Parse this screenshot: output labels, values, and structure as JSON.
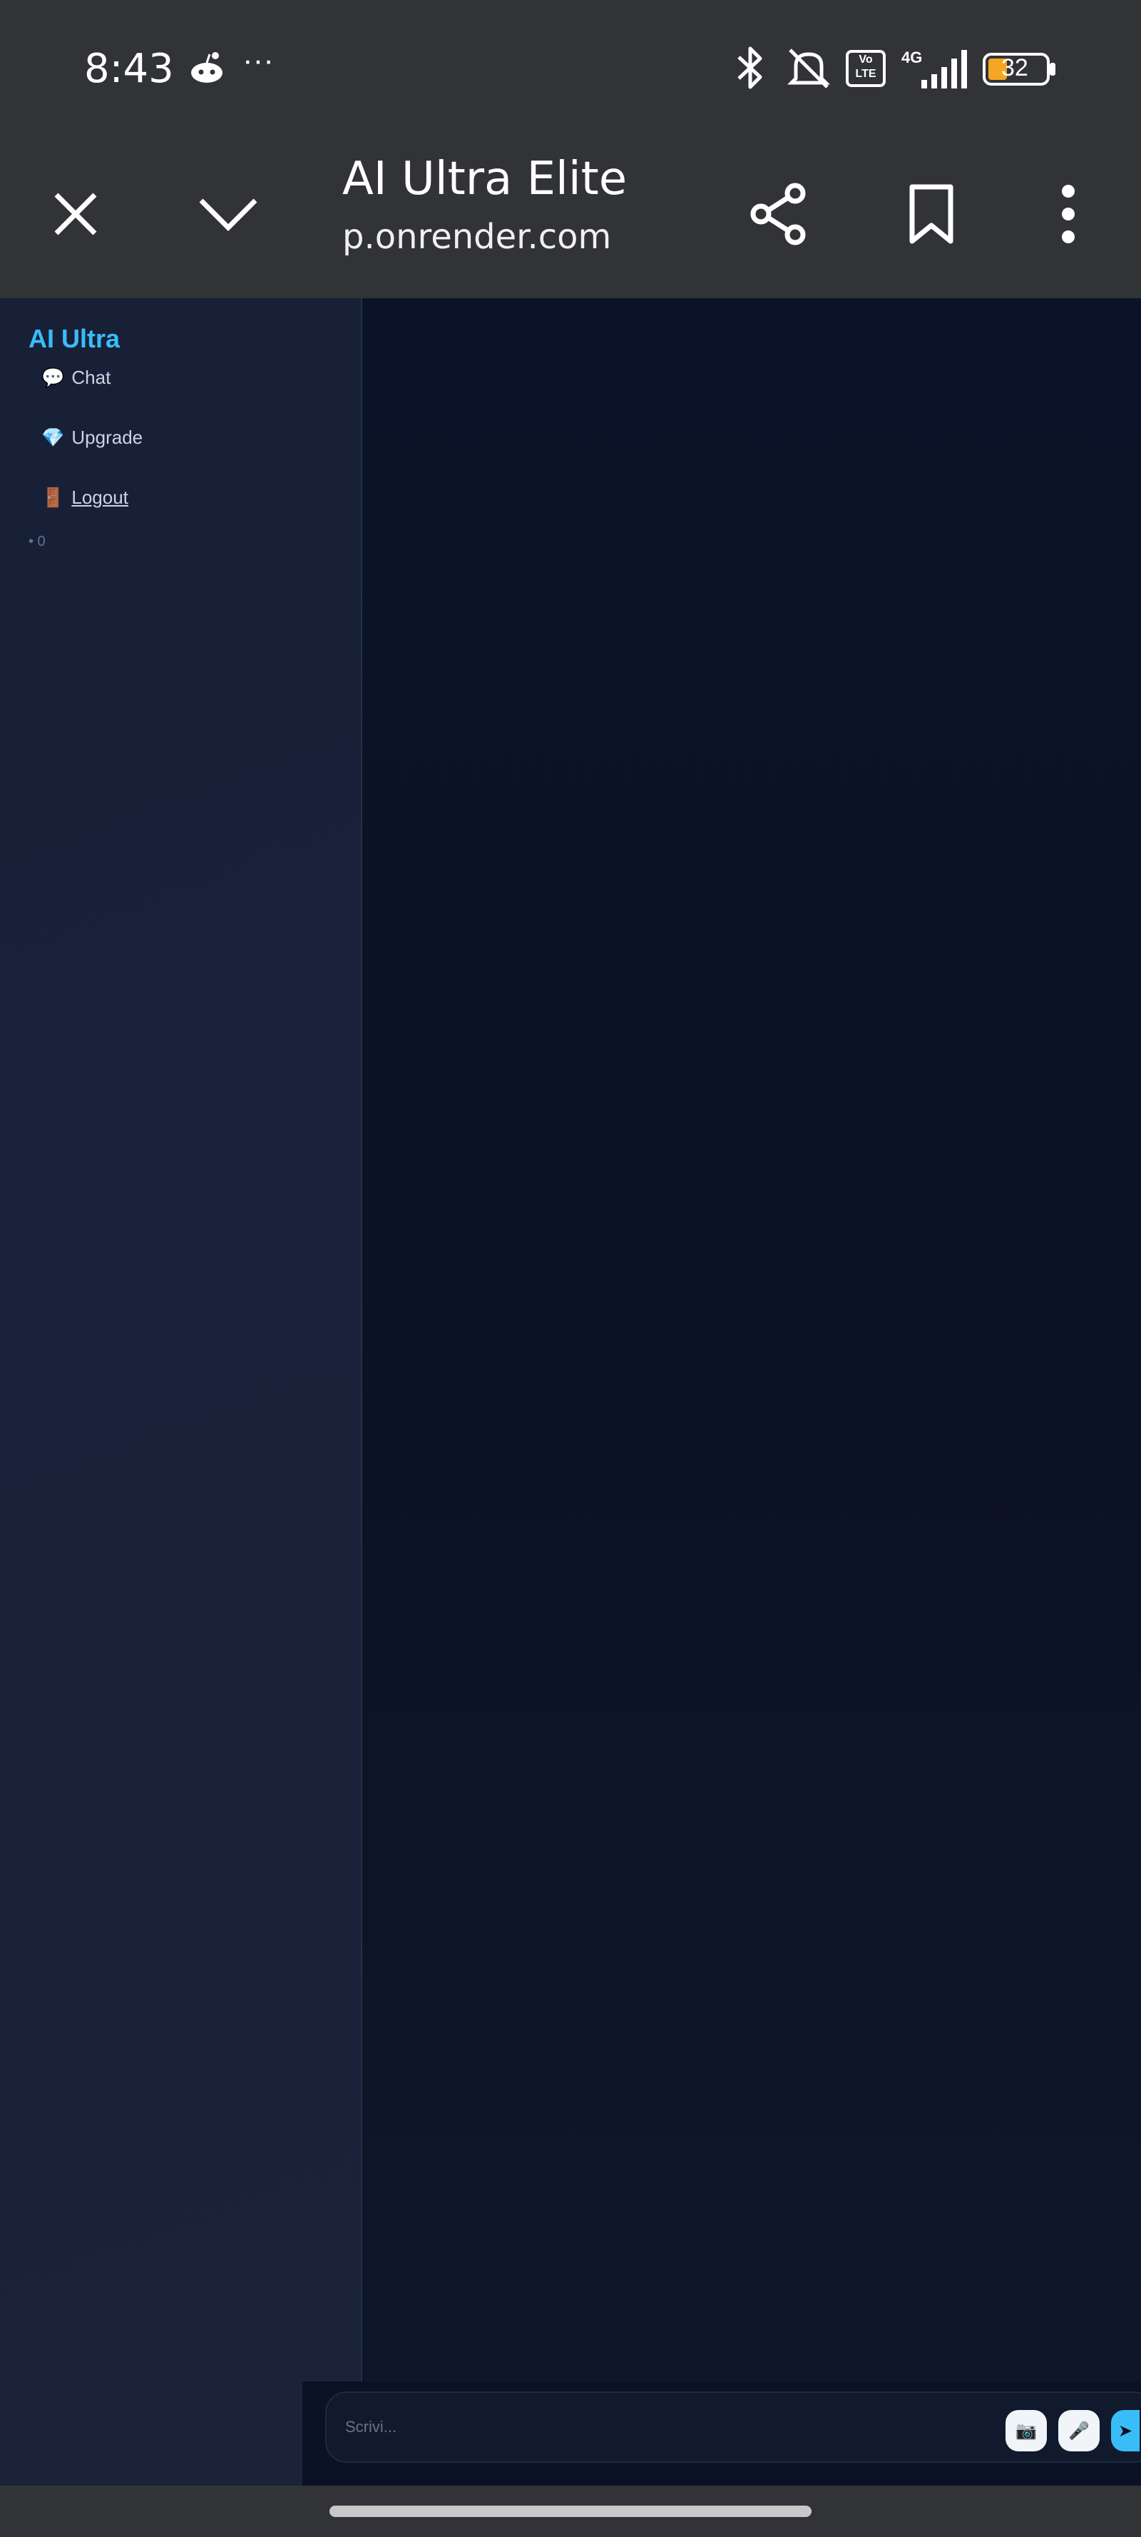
{
  "status_bar": {
    "time": "8:43",
    "more": "···",
    "network": "4G",
    "volte": "Vo LTE",
    "battery": "32"
  },
  "toolbar": {
    "title": "AI Ultra Elite",
    "url": "p.onrender.com"
  },
  "sidebar": {
    "brand": "AI Ultra",
    "items": [
      {
        "icon": "💬",
        "label": "Chat"
      },
      {
        "icon": "💎",
        "label": "Upgrade"
      },
      {
        "icon": "🚪",
        "label": "Logout"
      }
    ],
    "counter": "• 0"
  },
  "composer": {
    "placeholder": "Scrivi...",
    "camera_icon": "📷",
    "mic_icon": "🎤",
    "send_icon": "➤"
  },
  "colors": {
    "accent": "#38bdf8",
    "bg": "#0b1223",
    "chrome": "#323336"
  }
}
